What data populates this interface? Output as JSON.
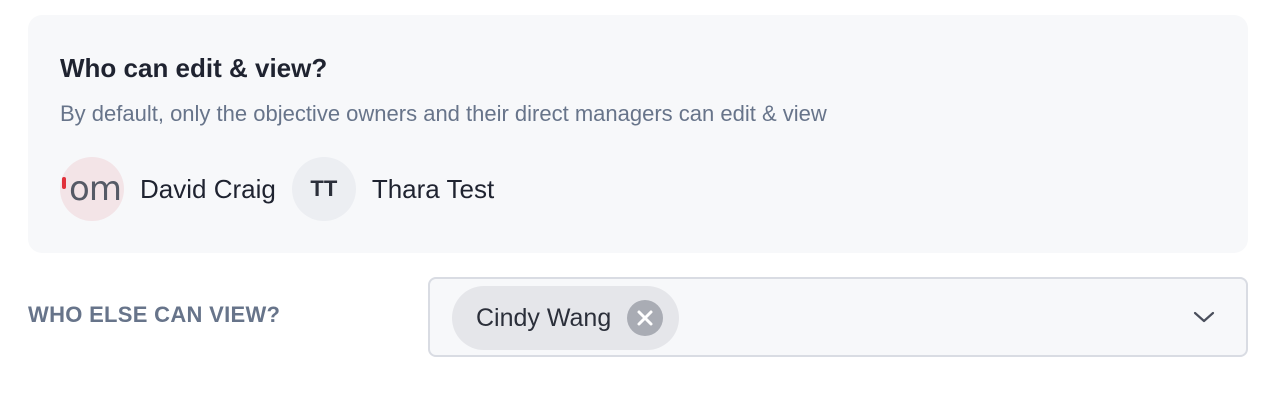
{
  "access_panel": {
    "title": "Who can edit & view?",
    "description": "By default, only the objective owners and their direct managers can edit & view",
    "people": [
      {
        "name": "David Craig",
        "avatar_type": "image",
        "avatar_text": "om"
      },
      {
        "name": "Thara Test",
        "avatar_type": "initials",
        "avatar_text": "TT"
      }
    ]
  },
  "viewers": {
    "label": "WHO ELSE CAN VIEW?",
    "selected": [
      {
        "name": "Cindy Wang"
      }
    ],
    "dropdown_icon": "chevron-down-icon",
    "remove_icon": "close-icon"
  },
  "colors": {
    "panel_bg": "#f7f8fa",
    "muted_text": "#67748a",
    "chip_bg": "#e5e6ea",
    "chip_remove_bg": "#a9acb4"
  }
}
